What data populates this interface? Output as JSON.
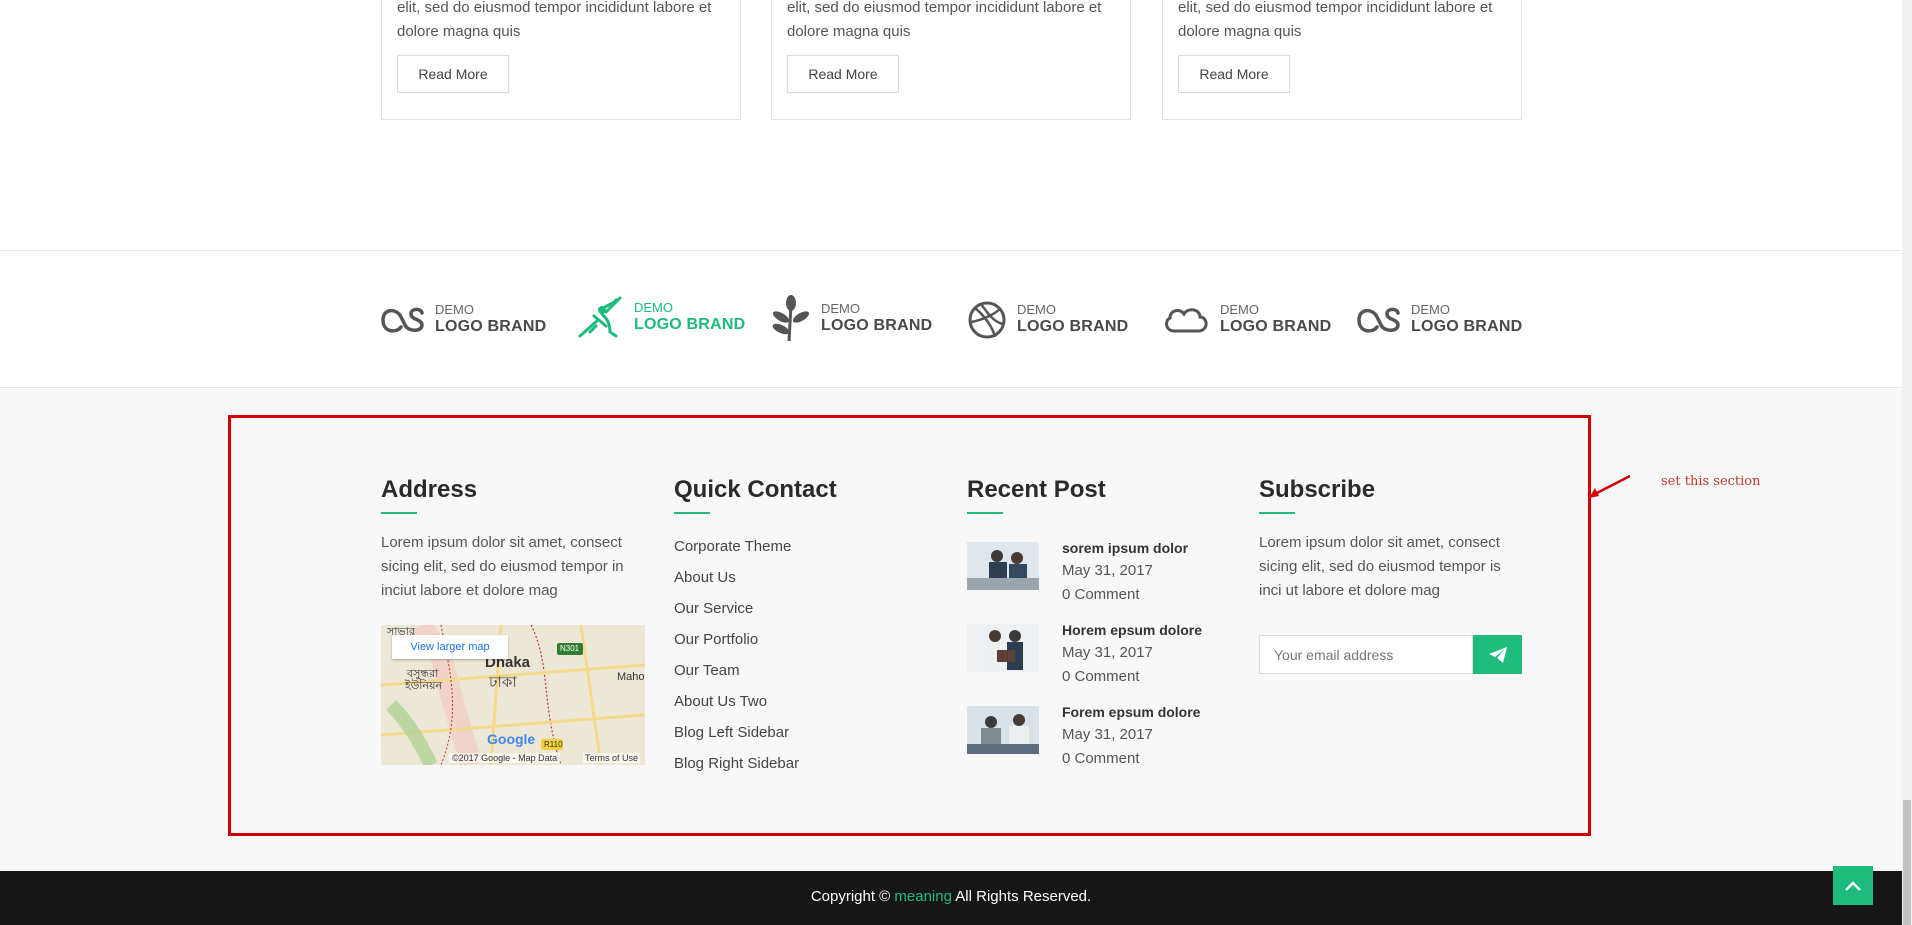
{
  "cards": [
    {
      "text": "elit, sed do eiusmod tempor incididunt labore et dolore magna  quis",
      "button": "Read More"
    },
    {
      "text": "elit, sed do eiusmod tempor incididunt labore et dolore magna quis",
      "button": "Read More"
    },
    {
      "text": "elit, sed do eiusmod tempor incididunt labore et dolore magna  quis",
      "button": "Read More"
    }
  ],
  "brands": [
    {
      "top": "DEMO",
      "name": "LOGO BRAND",
      "icon": "lastfm-icon"
    },
    {
      "top": "DEMO",
      "name": "LOGO BRAND",
      "icon": "warrior-icon",
      "active": true
    },
    {
      "top": "DEMO",
      "name": "LOGO BRAND",
      "icon": "leaf-icon"
    },
    {
      "top": "DEMO",
      "name": "LOGO BRAND",
      "icon": "dribbble-icon"
    },
    {
      "top": "DEMO",
      "name": "LOGO BRAND",
      "icon": "cloud-icon"
    },
    {
      "top": "DEMO",
      "name": "LOGO BRAND",
      "icon": "lastfm-icon"
    }
  ],
  "address": {
    "title": "Address",
    "text": "Lorem ipsum dolor sit amet, consect sicing elit, sed do eiusmod tempor in inciut labore et dolore mag",
    "map": {
      "link": "View larger map",
      "city": "Dhaka",
      "city_local": "ঢাকা",
      "labels": [
        "সাভার",
        "বসুন্ধরা",
        "ইউনিয়ন",
        "Maho",
        "N301",
        "R110"
      ],
      "provider": "Google",
      "attribution": "©2017 Google - Map Data",
      "terms": "Terms of Use"
    }
  },
  "quick_contact": {
    "title": "Quick Contact",
    "links": [
      "Corporate Theme",
      "About Us",
      "Our Service",
      "Our Portfolio",
      "Our Team",
      "About Us Two",
      "Blog Left Sidebar",
      "Blog Right Sidebar"
    ]
  },
  "recent_post": {
    "title": "Recent Post",
    "posts": [
      {
        "title": "sorem ipsum dolor",
        "date": "May 31, 2017",
        "comments": "0 Comment"
      },
      {
        "title": "Horem epsum dolore",
        "date": "May 31, 2017",
        "comments": "0 Comment"
      },
      {
        "title": "Forem epsum dolore",
        "date": "May 31, 2017",
        "comments": "0 Comment"
      }
    ]
  },
  "subscribe": {
    "title": "Subscribe",
    "text": "Lorem ipsum dolor sit amet, consect sicing elit, sed do eiusmod tempor is inci ut labore et dolore mag",
    "placeholder": "Your email address"
  },
  "annotation": {
    "text": "set this section",
    "color": "#d40000"
  },
  "copyright": {
    "prefix": "Copyright ©",
    "brand": "meaning",
    "suffix": "All Rights Reserved."
  },
  "colors": {
    "accent": "#1ebc7c",
    "footer_bg": "#f8f8f8",
    "bottom_bg": "#161616"
  }
}
